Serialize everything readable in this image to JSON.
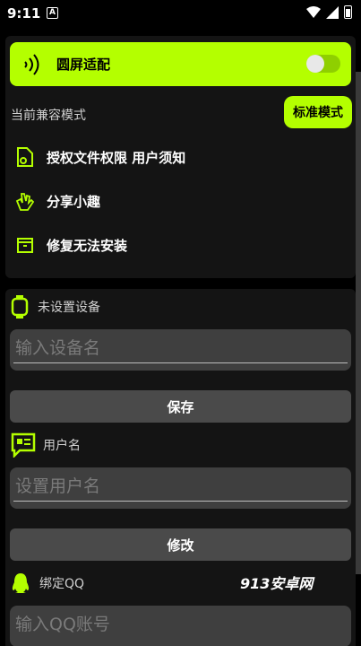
{
  "status_bar": {
    "time": "9:11",
    "notif_letter": "A"
  },
  "banner": {
    "title": "圆屏适配",
    "toggle_on": false
  },
  "compat": {
    "label": "当前兼容模式",
    "mode_button": "标准模式"
  },
  "menu": [
    {
      "icon": "file-permission-icon",
      "label": "授权文件权限 用户须知"
    },
    {
      "icon": "clap-hands-icon",
      "label": "分享小趣"
    },
    {
      "icon": "package-repair-icon",
      "label": "修复无法安装"
    }
  ],
  "device": {
    "label": "未设置设备",
    "placeholder": "输入设备名",
    "button": "保存"
  },
  "username": {
    "label": "用户名",
    "placeholder": "设置用户名",
    "button": "修改"
  },
  "qq": {
    "label": "绑定QQ",
    "placeholder": "输入QQ账号"
  },
  "watermark": "913安卓网",
  "colors": {
    "accent": "#b4ff00",
    "card": "#141414",
    "input": "#3f3f3f",
    "button": "#4a4a4a"
  }
}
